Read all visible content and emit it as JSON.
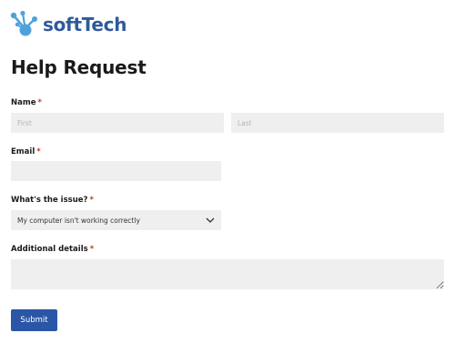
{
  "brand": {
    "name": "softTech",
    "color": "#2f5a9c",
    "logo_icon_color": "#4da3d9"
  },
  "form": {
    "title": "Help Request",
    "required_marker": "*",
    "name": {
      "label": "Name",
      "first_placeholder": "First",
      "last_placeholder": "Last"
    },
    "email": {
      "label": "Email",
      "value": ""
    },
    "issue": {
      "label": "What's the issue?",
      "selected": "My computer isn't working correctly"
    },
    "details": {
      "label": "Additional details",
      "value": ""
    },
    "submit_label": "Submit",
    "submit_color": "#2b56a6",
    "required_color": "#c0392b",
    "field_background": "#efefef"
  }
}
